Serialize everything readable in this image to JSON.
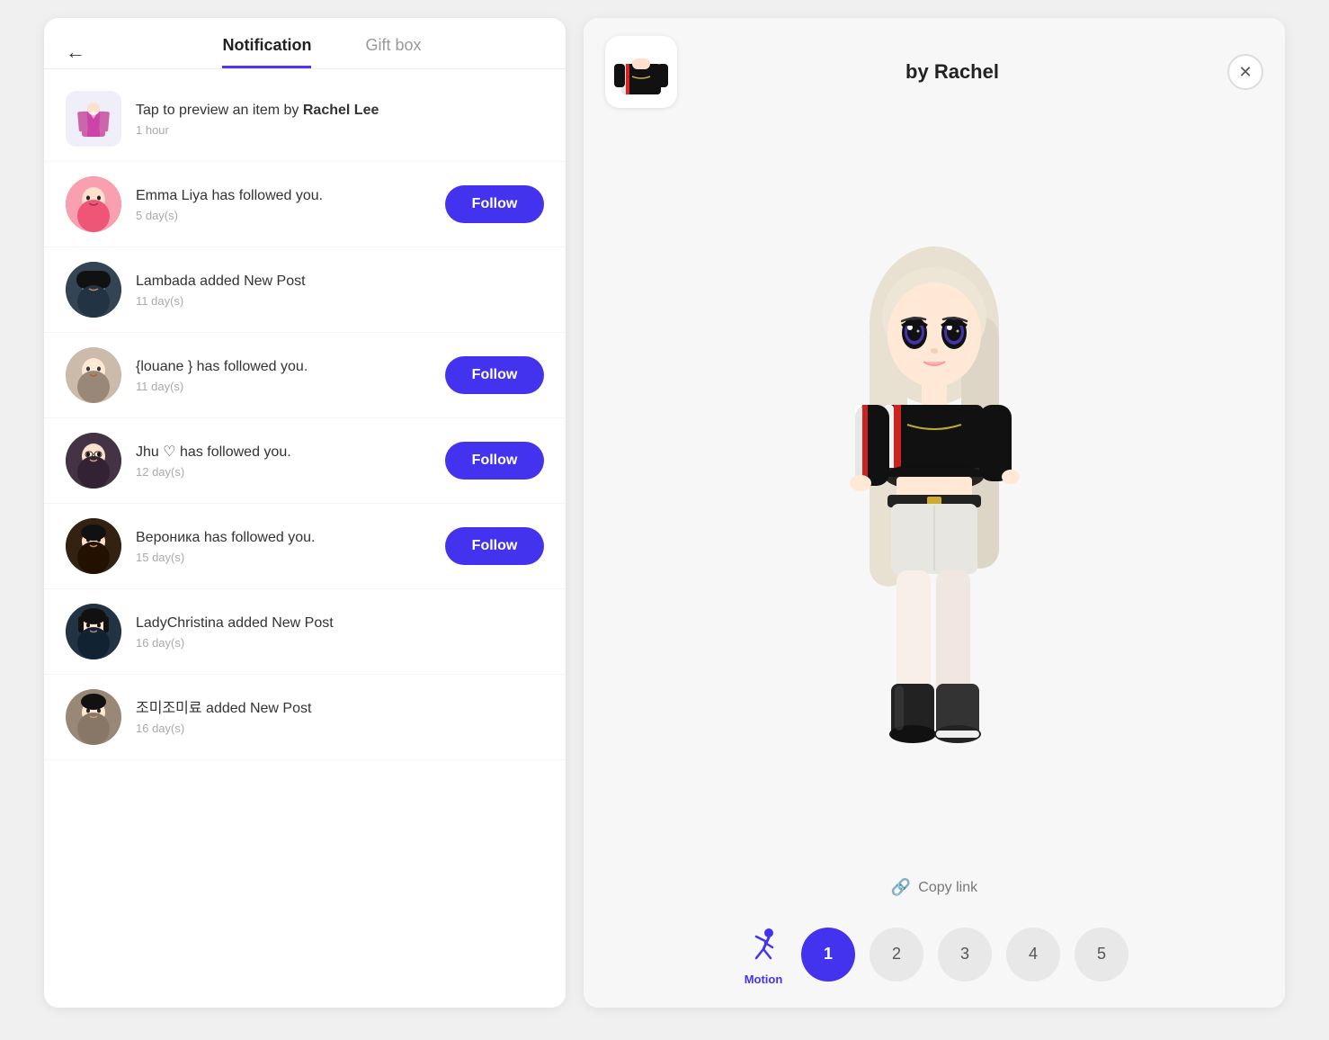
{
  "left": {
    "back_label": "←",
    "tabs": [
      {
        "id": "notification",
        "label": "Notification",
        "active": true
      },
      {
        "id": "giftbox",
        "label": "Gift box",
        "active": false
      }
    ],
    "notifications": [
      {
        "id": "item-preview",
        "avatar_type": "outfit",
        "avatar_emoji": "👗",
        "text": "Tap to preview an item by ",
        "bold": "Rachel Lee",
        "time": "1 hour",
        "has_follow": false
      },
      {
        "id": "emma",
        "avatar_type": "user",
        "avatar_class": "av-emma",
        "avatar_emoji": "🧑",
        "text": "Emma Liya has followed you.",
        "time": "5 day(s)",
        "has_follow": true,
        "follow_label": "Follow"
      },
      {
        "id": "lambada",
        "avatar_type": "user",
        "avatar_class": "av-lambada",
        "avatar_emoji": "👤",
        "text": "Lambada added New Post",
        "time": "11 day(s)",
        "has_follow": false
      },
      {
        "id": "louane",
        "avatar_type": "user",
        "avatar_class": "av-louane",
        "avatar_emoji": "👤",
        "text": "{louane } has followed you.",
        "time": "11 day(s)",
        "has_follow": true,
        "follow_label": "Follow"
      },
      {
        "id": "jhu",
        "avatar_type": "user",
        "avatar_class": "av-jhu",
        "avatar_emoji": "👤",
        "text": "Jhu ♡ has followed you.",
        "time": "12 day(s)",
        "has_follow": true,
        "follow_label": "Follow"
      },
      {
        "id": "veronika",
        "avatar_type": "user",
        "avatar_class": "av-veronika",
        "avatar_emoji": "👤",
        "text": "Вероника has followed you.",
        "time": "15 day(s)",
        "has_follow": true,
        "follow_label": "Follow"
      },
      {
        "id": "ladychristina",
        "avatar_type": "user",
        "avatar_class": "av-lady",
        "avatar_emoji": "👤",
        "text": "LadyChristina added New Post",
        "time": "16 day(s)",
        "has_follow": false
      },
      {
        "id": "korean",
        "avatar_type": "user",
        "avatar_class": "av-korean",
        "avatar_emoji": "👤",
        "text": "조미조미료 added New Post",
        "time": "16 day(s)",
        "has_follow": false
      }
    ]
  },
  "right": {
    "title": "by Rachel",
    "close_label": "✕",
    "copy_link_label": "Copy link",
    "motion_label": "Motion",
    "num_buttons": [
      "1",
      "2",
      "3",
      "4",
      "5"
    ],
    "active_num": 1
  }
}
